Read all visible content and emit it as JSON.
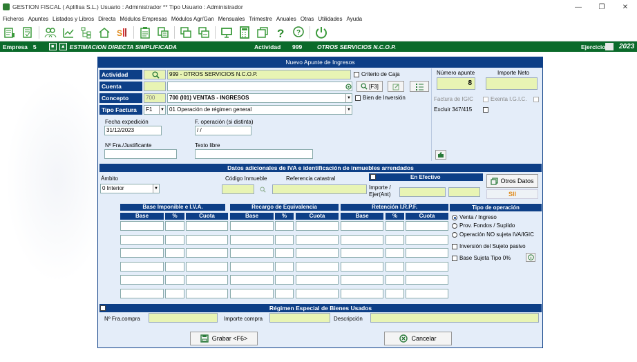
{
  "window": {
    "title": "GESTION FISCAL  ( Aplifisa S.L.)   Usuario : Administrador  **  Tipo Usuario : Administrador"
  },
  "menu": [
    "Ficheros",
    "Apuntes",
    "Listados y Libros",
    "Directa",
    "Módulos Empresas",
    "Módulos Agr/Gan",
    "Mensuales",
    "Trimestre",
    "Anuales",
    "Otras",
    "Utilidades",
    "Ayuda"
  ],
  "toolbar_icons": [
    "ledger-icon",
    "ledger-book-icon",
    "people-icon",
    "chart-icon",
    "tree-icon",
    "home-icon",
    "sii-icon",
    "clipboard-icon",
    "document-list-icon",
    "copy-icon",
    "copy-2-icon",
    "monitor-icon",
    "calculator-icon",
    "window-icon",
    "help-icon",
    "chat-help-icon",
    "power-icon"
  ],
  "status": {
    "empresa_label": "Empresa",
    "empresa_num": "5",
    "regime": "ESTIMACION DIRECTA SIMPLIFICADA",
    "actividad_label": "Actividad",
    "actividad_num": "999",
    "actividad_name": "OTROS SERVICIOS N.C.O.P.",
    "ejercicio_label": "Ejercicio",
    "ejercicio_year": "2023"
  },
  "dialog": {
    "title": "Nuevo Apunte de Ingresos",
    "actividad_label": "Actividad",
    "actividad_value": "999 - OTROS SERVICIOS N.C.O.P.",
    "criterio_caja": "Criterio de Caja",
    "cuenta_label": "Cuenta",
    "f3_label": "[F3]",
    "concepto_label": "Concepto",
    "concepto_code": "700",
    "concepto_value": "700  (I01)  VENTAS - INGRESOS",
    "bien_inversion": "Bien de Inversión",
    "tipo_factura_label": "Tipo Factura",
    "tipo_factura_code": "F1",
    "tipo_factura_value": "01    Operación de régimen general",
    "numero_apunte_label": "Número apunte",
    "numero_apunte_value": "8",
    "importe_neto_label": "Importe Neto",
    "factura_igic": "Factura de IGIC",
    "exenta_igic": "Exenta I.G.I.C.",
    "excluir_347": "Excluir 347/415",
    "fecha_expedicion_label": "Fecha expedición",
    "fecha_expedicion_value": "31/12/2023",
    "f_operacion_label": "F. operación (si distinta)",
    "f_operacion_value": " /  /",
    "nfra_label": "Nº Fra./Justificante",
    "texto_libre_label": "Texto libre",
    "datos_adicionales": "Datos adicionales de IVA e identificación de inmuebles arrendados",
    "ambito_label": "Ámbito",
    "ambito_value": "0  Interior",
    "codigo_inmueble_label": "Código Inmueble",
    "referencia_catastral_label": "Referencia catastral",
    "en_efectivo": "En Efectivo",
    "importe_ejer_label_1": "Importe /",
    "importe_ejer_label_2": "Ejer(Ant)",
    "otros_datos": "Otros Datos",
    "sii_badge": "SII",
    "bi_header": "Base Imponible e I.V.A.",
    "re_header": "Recargo de Equivalencia",
    "ret_header": "Retención I.R.P.F.",
    "col_base": "Base",
    "col_pct": "%",
    "col_cuota": "Cuota",
    "tipo_operacion_label": "Tipo de operación",
    "op_venta": "Venta / Ingreso",
    "op_prov": "Prov. Fondos / Suplido",
    "op_no_sujeta": "Operación NO sujeta IVA/IGIC",
    "inversion_sujeto": "Inversión del Sujeto pasivo",
    "base_sujeta": "Base Sujeta Tipo 0%",
    "bienes_usados": "Régimen Especial de Bienes Usados",
    "nfra_compra_label": "Nº Fra.compra",
    "importe_compra_label": "Importe compra",
    "descripcion_label": "Descripción",
    "grabar": "Grabar <F6>",
    "cancelar": "Cancelar"
  },
  "colors": {
    "navy": "#0d3f87",
    "green_bar": "#0a6a2a",
    "input_yellow": "#e8f4b4",
    "dialog_bg": "#e4edf9"
  }
}
